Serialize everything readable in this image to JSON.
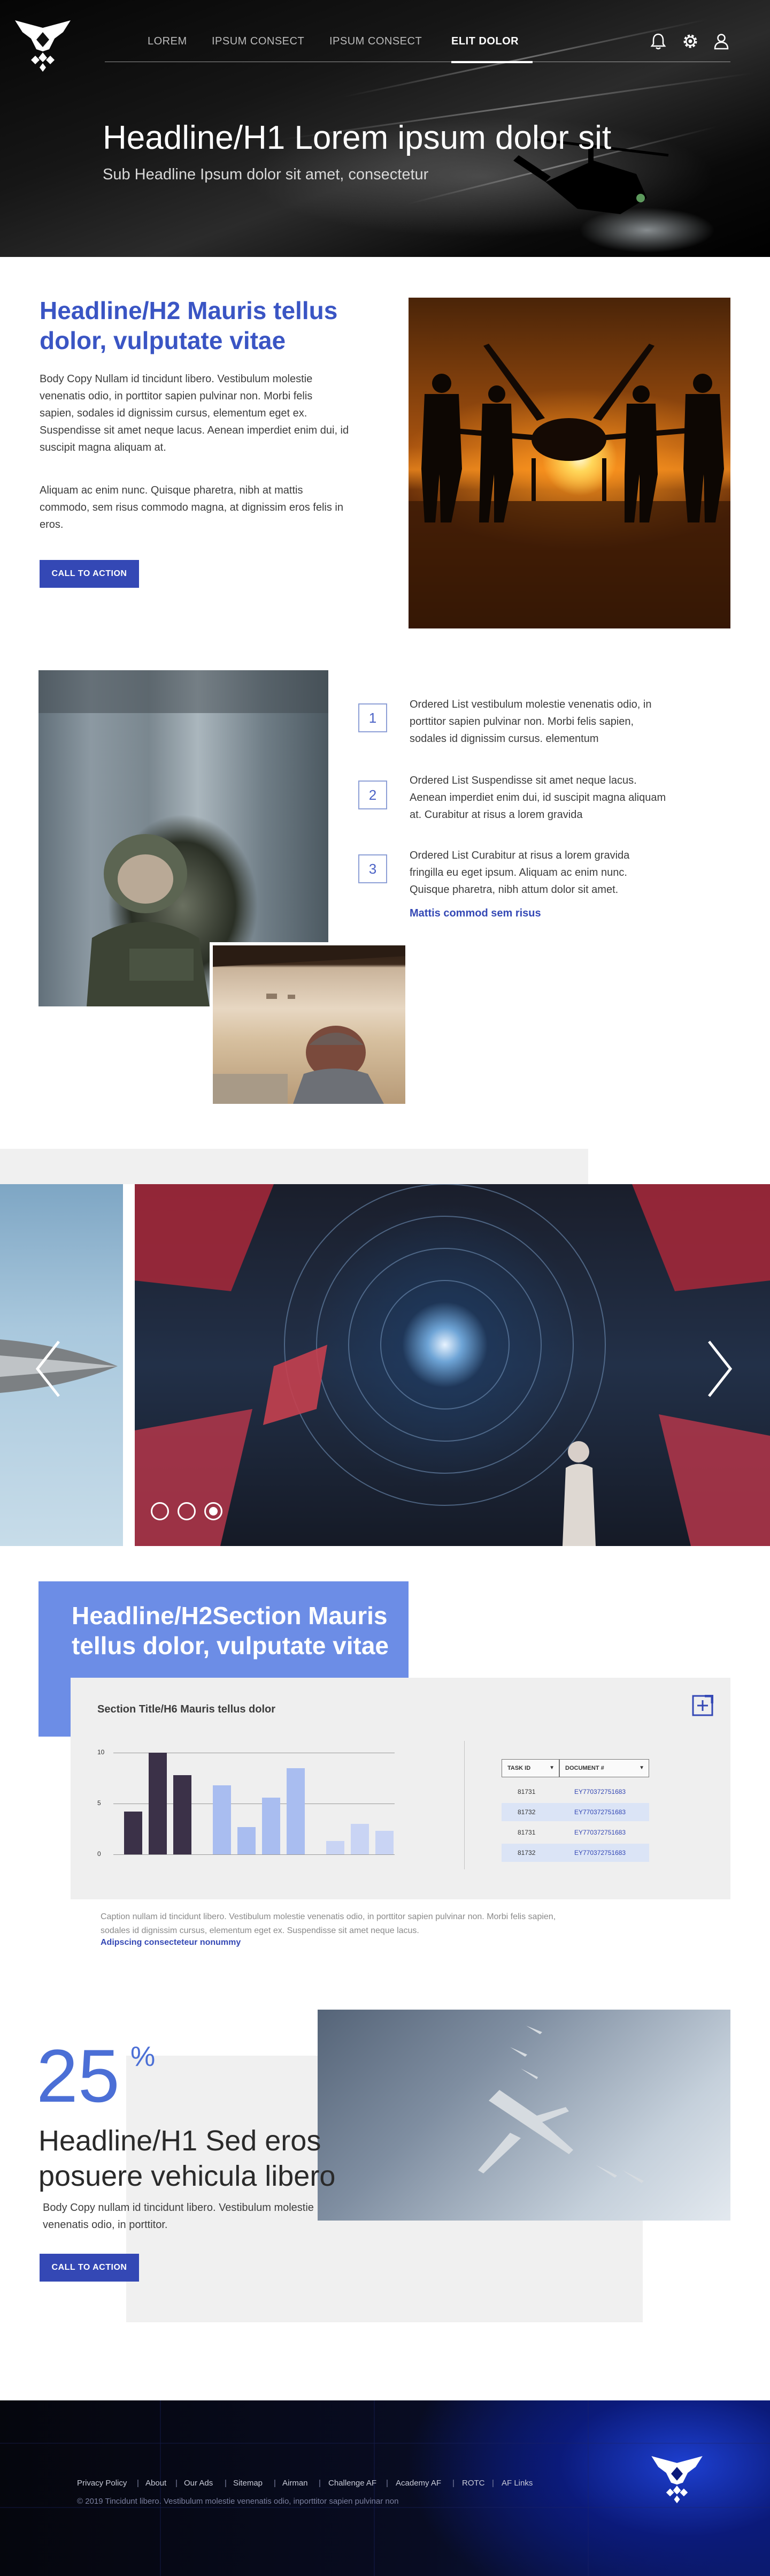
{
  "nav": {
    "items": [
      {
        "label": "LOREM"
      },
      {
        "label": "IPSUM CONSECT"
      },
      {
        "label": "IPSUM CONSECT"
      },
      {
        "label": "ELIT DOLOR"
      }
    ],
    "active_index": 3,
    "icons": [
      "bell-icon",
      "gear-icon",
      "user-icon"
    ]
  },
  "hero": {
    "title": "Headline/H1 Lorem ipsum dolor sit",
    "subtitle": "Sub Headline Ipsum dolor sit amet, consectetur"
  },
  "intro": {
    "title": "Headline/H2 Mauris tellus dolor, vulputate vitae",
    "para1": "Body Copy Nullam id tincidunt libero. Vestibulum molestie venenatis odio, in porttitor sapien pulvinar non. Morbi felis sapien, sodales id dignissim cursus, elementum eget ex. Suspendisse sit amet neque lacus. Aenean imperdiet enim dui, id suscipit magna aliquam at.",
    "para2": "Aliquam ac enim nunc. Quisque pharetra, nibh at mattis commodo, sem risus commodo magna, at dignissim eros felis in eros.",
    "cta": "CALL TO ACTION"
  },
  "ordered_list": {
    "items": [
      {
        "num": "1",
        "text": "Ordered List vestibulum molestie venenatis odio, in porttitor sapien pulvinar non. Morbi felis sapien, sodales id dignissim cursus. elementum"
      },
      {
        "num": "2",
        "text": "Ordered List Suspendisse sit amet neque lacus. Aenean imperdiet enim dui, id suscipit magna aliquam at. Curabitur at risus a lorem gravida"
      },
      {
        "num": "3",
        "text": "Ordered List Curabitur at risus a lorem gravida fringilla eu eget ipsum. Aliquam ac enim nunc. Quisque pharetra, nibh attum dolor sit amet."
      }
    ],
    "link": "Mattis commod sem risus"
  },
  "carousel": {
    "slide_count": 3,
    "active_slide": 3
  },
  "chart_section": {
    "title": "Headline/H2Section Mauris tellus dolor, vulputate vitae",
    "card_title": "Section Title/H6 Mauris tellus dolor",
    "caption": "Caption nullam id tincidunt libero. Vestibulum molestie venenatis odio, in porttitor sapien pulvinar non. Morbi felis sapien, sodales id dignissim cursus, elementum eget ex. Suspendisse sit amet neque lacus.",
    "caption_link": "Adipscing consecteteur nonummy",
    "table": {
      "headers": [
        "TASK ID",
        "DOCUMENT #"
      ],
      "rows": [
        [
          "81731",
          "EY770372751683"
        ],
        [
          "81732",
          "EY770372751683"
        ],
        [
          "81731",
          "EY770372751683"
        ],
        [
          "81732",
          "EY770372751683"
        ]
      ]
    }
  },
  "chart_data": {
    "type": "bar",
    "ylim": [
      0,
      10
    ],
    "yticks": [
      "0",
      "5",
      "10"
    ],
    "series": [
      {
        "color": "#3b3148",
        "values": [
          4.2,
          10,
          7.8
        ]
      },
      {
        "color": "#a9bdf0",
        "values": [
          6.8,
          2.7,
          5.6,
          8.5
        ]
      },
      {
        "color": "#c9d4f4",
        "values": [
          1.3,
          3.0,
          2.3
        ]
      }
    ]
  },
  "stat": {
    "number": "25",
    "unit": "%",
    "title": "Headline/H1 Sed eros posuere vehicula libero",
    "body": "Body Copy nullam id tincidunt libero. Vestibulum molestie venenatis odio, in porttitor.",
    "cta": "CALL TO ACTION"
  },
  "footer": {
    "links": [
      "Privacy Policy",
      "About",
      "Our Ads",
      "Sitemap",
      "Airman",
      "Challenge AF",
      "Academy AF",
      "ROTC",
      "AF Links"
    ],
    "copyright": "© 2019 Tincidunt libero. Vestibulum molestie venenatis odio, inporttitor sapien pulvinar non"
  },
  "colors": {
    "accent": "#3a55c4",
    "button": "#3448b5",
    "chart_title_box": "#6c8de6",
    "footer": "#0b1a7a"
  }
}
